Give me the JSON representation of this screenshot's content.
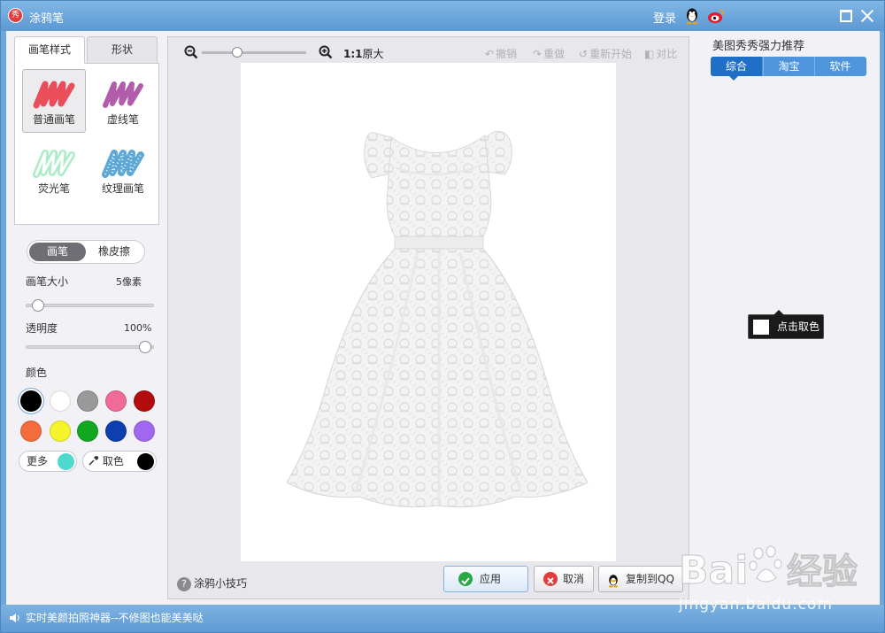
{
  "app": {
    "title": "涂鸦笔",
    "login": "登录"
  },
  "left": {
    "tabs": [
      "画笔样式",
      "形状"
    ],
    "brushes": [
      "普通画笔",
      "虚线笔",
      "荧光笔",
      "纹理画笔"
    ],
    "mode": {
      "brush": "画笔",
      "eraser": "橡皮擦"
    },
    "size": {
      "label": "画笔大小",
      "value": "5像素"
    },
    "opacity": {
      "label": "透明度",
      "value": "100%"
    },
    "color_label": "颜色",
    "colors": [
      "#000000",
      "#ffffff",
      "#999999",
      "#f06b97",
      "#b20c0c",
      "#f26c3c",
      "#f5f42c",
      "#11a81f",
      "#0d3fb0",
      "#a067f0"
    ],
    "more_label": "更多",
    "more_color": "#4ed9cf",
    "pick_label": "取色",
    "pick_color": "#000000"
  },
  "center": {
    "zoom_ratio": "1:1",
    "zoom_label": "原大",
    "undo": "撤销",
    "redo": "重做",
    "restart": "重新开始",
    "compare": "对比",
    "tips": "涂鸦小技巧",
    "apply": "应用",
    "cancel": "取消",
    "copy_qq": "复制到QQ"
  },
  "right": {
    "title": "美图秀秀强力推荐",
    "tabs": [
      "综合",
      "淘宝",
      "软件"
    ],
    "pick_tip": "点击取色"
  },
  "status": {
    "text": "实时美颜拍照神器--不修图也能美美哒"
  },
  "watermark": {
    "main": "Bai度经验",
    "sub": "jingyan.baidu.com"
  }
}
